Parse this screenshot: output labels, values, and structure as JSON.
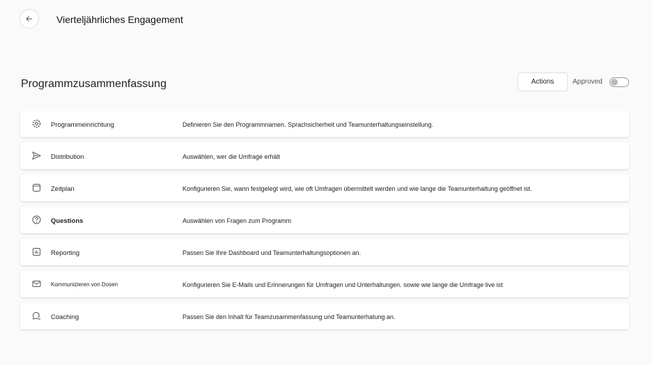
{
  "header": {
    "title": "Vierteljährliches Engagement"
  },
  "section": {
    "title": "Programmzusammenfassung",
    "actions_label": "Actions",
    "approved_label": "Approved",
    "approved_toggle": false
  },
  "rows": [
    {
      "icon": "gear-icon",
      "label": "Programmeinrichtung",
      "desc": "Definieren Sie den Programmnamen. Sprachsicherheit und Teamunterhaltungseinstellung."
    },
    {
      "icon": "send-icon",
      "label": "Distribution",
      "desc": "Auswählen, wer die Umfrage erhält"
    },
    {
      "icon": "calendar-icon",
      "label": "Zeitplan",
      "desc": "Konfigurieren Sie, wann festgelegt wird, wie oft Umfragen übermittelt werden und wie lange die Teamunterhaltung geöffnet ist."
    },
    {
      "icon": "question-icon",
      "label": "Questions",
      "desc": "Auswählen von Fragen zum Programm"
    },
    {
      "icon": "chart-icon",
      "label": "Reporting",
      "desc": "Passen Sie Ihre Dashboard und Teamunterhaltungsoptionen an."
    },
    {
      "icon": "mail-icon",
      "label": "Kommunizieren von Dosen",
      "desc": "Konfigurieren Sie E-Mails und Erinnerungen für Umfragen und Unterhaltungen. sowie wie lange die Umfrage live ist"
    },
    {
      "icon": "chat-icon",
      "label": "Coaching",
      "desc": "Passen Sie den Inhalt für Teamzusammenfassung und Teamunterhatung an."
    }
  ]
}
